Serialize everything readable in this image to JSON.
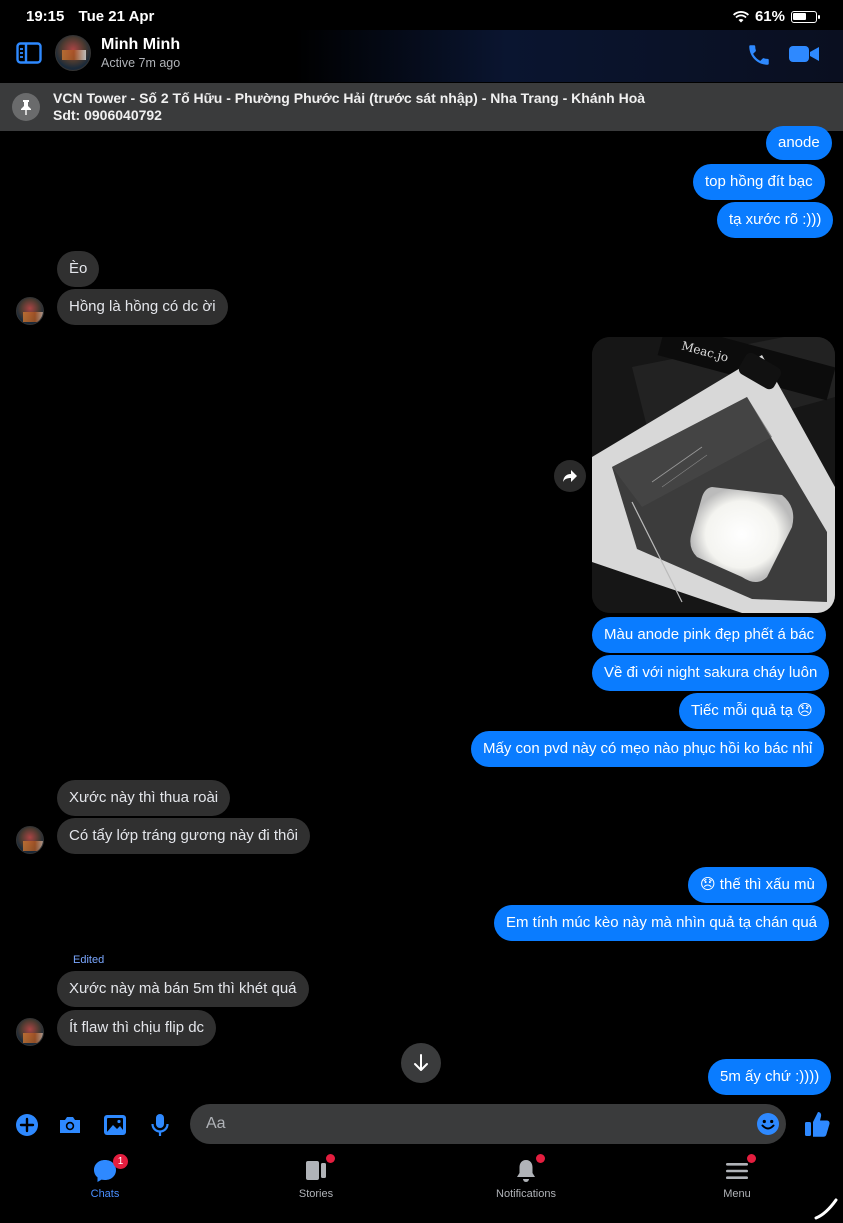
{
  "status_bar": {
    "time": "19:15",
    "date": "Tue 21 Apr",
    "battery": "61%",
    "battery_level": 0.61
  },
  "header": {
    "contact_name": "Minh Minh",
    "contact_status": "Active 7m ago"
  },
  "pinned": {
    "line1": "VCN Tower - Số 2 Tố Hữu - Phường Phước Hải (trước sát nhập) - Nha Trang - Khánh Hoà",
    "line2": "Sdt: 0906040792"
  },
  "messages": {
    "m1": "anode",
    "m2": "top hồng đít bạc",
    "m3": "tạ xước rõ :)))",
    "m4": "Èo",
    "m5": "Hồng là hồng có dc ời",
    "m6": "Màu anode pink đẹp phết á bác",
    "m7": "Về đi với night sakura cháy luôn",
    "m8": "Tiếc mỗi quả tạ 😞",
    "m9": "Mấy con pvd này có mẹo nào phục hồi ko bác nhỉ",
    "m10": "Xước này thì thua roài",
    "m11": "Có tẩy lớp tráng gương này đi thôi",
    "m12": "😞 thế thì xấu mù",
    "m13": "Em tính múc kèo này mà nhìn quả tạ chán quá",
    "edited": "Edited",
    "m14": "Xước này mà bán 5m thì khét quá",
    "m15": "Ít flaw thì chịu flip dc",
    "m16": "5m ấy chứ :))))"
  },
  "photo": {
    "label": "Meac.jo"
  },
  "composer": {
    "placeholder": "Aa"
  },
  "tabs": {
    "chats": {
      "label": "Chats",
      "badge": "1"
    },
    "stories": {
      "label": "Stories"
    },
    "notifications": {
      "label": "Notifications"
    },
    "menu": {
      "label": "Menu"
    }
  },
  "colors": {
    "sent_bubble": "#0a7cff",
    "received_bubble": "#303030",
    "accent": "#4a8fff",
    "badge": "#e41e3f"
  }
}
